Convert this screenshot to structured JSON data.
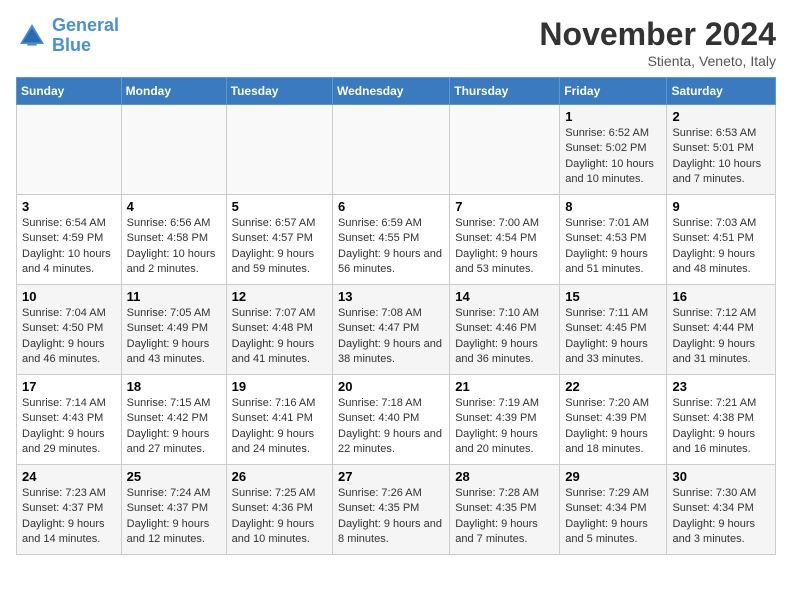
{
  "logo": {
    "line1": "General",
    "line2": "Blue"
  },
  "title": "November 2024",
  "subtitle": "Stienta, Veneto, Italy",
  "days_of_week": [
    "Sunday",
    "Monday",
    "Tuesday",
    "Wednesday",
    "Thursday",
    "Friday",
    "Saturday"
  ],
  "weeks": [
    [
      {
        "day": "",
        "info": ""
      },
      {
        "day": "",
        "info": ""
      },
      {
        "day": "",
        "info": ""
      },
      {
        "day": "",
        "info": ""
      },
      {
        "day": "",
        "info": ""
      },
      {
        "day": "1",
        "info": "Sunrise: 6:52 AM\nSunset: 5:02 PM\nDaylight: 10 hours and 10 minutes."
      },
      {
        "day": "2",
        "info": "Sunrise: 6:53 AM\nSunset: 5:01 PM\nDaylight: 10 hours and 7 minutes."
      }
    ],
    [
      {
        "day": "3",
        "info": "Sunrise: 6:54 AM\nSunset: 4:59 PM\nDaylight: 10 hours and 4 minutes."
      },
      {
        "day": "4",
        "info": "Sunrise: 6:56 AM\nSunset: 4:58 PM\nDaylight: 10 hours and 2 minutes."
      },
      {
        "day": "5",
        "info": "Sunrise: 6:57 AM\nSunset: 4:57 PM\nDaylight: 9 hours and 59 minutes."
      },
      {
        "day": "6",
        "info": "Sunrise: 6:59 AM\nSunset: 4:55 PM\nDaylight: 9 hours and 56 minutes."
      },
      {
        "day": "7",
        "info": "Sunrise: 7:00 AM\nSunset: 4:54 PM\nDaylight: 9 hours and 53 minutes."
      },
      {
        "day": "8",
        "info": "Sunrise: 7:01 AM\nSunset: 4:53 PM\nDaylight: 9 hours and 51 minutes."
      },
      {
        "day": "9",
        "info": "Sunrise: 7:03 AM\nSunset: 4:51 PM\nDaylight: 9 hours and 48 minutes."
      }
    ],
    [
      {
        "day": "10",
        "info": "Sunrise: 7:04 AM\nSunset: 4:50 PM\nDaylight: 9 hours and 46 minutes."
      },
      {
        "day": "11",
        "info": "Sunrise: 7:05 AM\nSunset: 4:49 PM\nDaylight: 9 hours and 43 minutes."
      },
      {
        "day": "12",
        "info": "Sunrise: 7:07 AM\nSunset: 4:48 PM\nDaylight: 9 hours and 41 minutes."
      },
      {
        "day": "13",
        "info": "Sunrise: 7:08 AM\nSunset: 4:47 PM\nDaylight: 9 hours and 38 minutes."
      },
      {
        "day": "14",
        "info": "Sunrise: 7:10 AM\nSunset: 4:46 PM\nDaylight: 9 hours and 36 minutes."
      },
      {
        "day": "15",
        "info": "Sunrise: 7:11 AM\nSunset: 4:45 PM\nDaylight: 9 hours and 33 minutes."
      },
      {
        "day": "16",
        "info": "Sunrise: 7:12 AM\nSunset: 4:44 PM\nDaylight: 9 hours and 31 minutes."
      }
    ],
    [
      {
        "day": "17",
        "info": "Sunrise: 7:14 AM\nSunset: 4:43 PM\nDaylight: 9 hours and 29 minutes."
      },
      {
        "day": "18",
        "info": "Sunrise: 7:15 AM\nSunset: 4:42 PM\nDaylight: 9 hours and 27 minutes."
      },
      {
        "day": "19",
        "info": "Sunrise: 7:16 AM\nSunset: 4:41 PM\nDaylight: 9 hours and 24 minutes."
      },
      {
        "day": "20",
        "info": "Sunrise: 7:18 AM\nSunset: 4:40 PM\nDaylight: 9 hours and 22 minutes."
      },
      {
        "day": "21",
        "info": "Sunrise: 7:19 AM\nSunset: 4:39 PM\nDaylight: 9 hours and 20 minutes."
      },
      {
        "day": "22",
        "info": "Sunrise: 7:20 AM\nSunset: 4:39 PM\nDaylight: 9 hours and 18 minutes."
      },
      {
        "day": "23",
        "info": "Sunrise: 7:21 AM\nSunset: 4:38 PM\nDaylight: 9 hours and 16 minutes."
      }
    ],
    [
      {
        "day": "24",
        "info": "Sunrise: 7:23 AM\nSunset: 4:37 PM\nDaylight: 9 hours and 14 minutes."
      },
      {
        "day": "25",
        "info": "Sunrise: 7:24 AM\nSunset: 4:37 PM\nDaylight: 9 hours and 12 minutes."
      },
      {
        "day": "26",
        "info": "Sunrise: 7:25 AM\nSunset: 4:36 PM\nDaylight: 9 hours and 10 minutes."
      },
      {
        "day": "27",
        "info": "Sunrise: 7:26 AM\nSunset: 4:35 PM\nDaylight: 9 hours and 8 minutes."
      },
      {
        "day": "28",
        "info": "Sunrise: 7:28 AM\nSunset: 4:35 PM\nDaylight: 9 hours and 7 minutes."
      },
      {
        "day": "29",
        "info": "Sunrise: 7:29 AM\nSunset: 4:34 PM\nDaylight: 9 hours and 5 minutes."
      },
      {
        "day": "30",
        "info": "Sunrise: 7:30 AM\nSunset: 4:34 PM\nDaylight: 9 hours and 3 minutes."
      }
    ]
  ]
}
